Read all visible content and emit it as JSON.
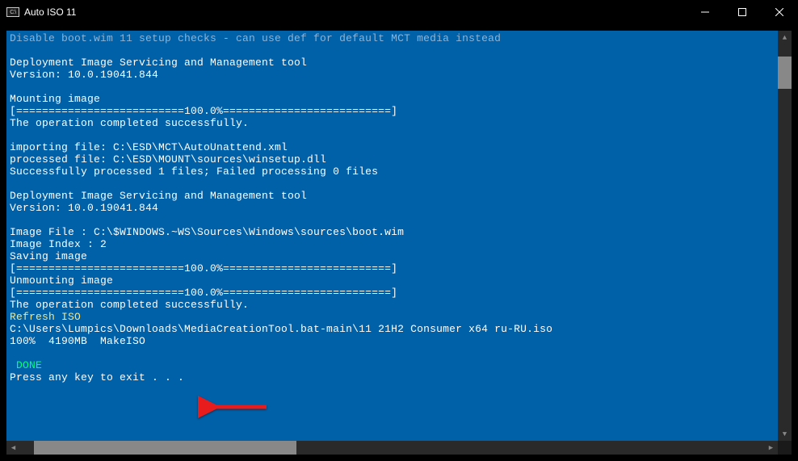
{
  "window": {
    "title": "Auto ISO 11"
  },
  "terminal": {
    "lines": [
      {
        "text": "Disable boot.wim 11 setup checks - can use def for default MCT media instead",
        "class": "gray-text"
      },
      {
        "text": "",
        "class": ""
      },
      {
        "text": "Deployment Image Servicing and Management tool",
        "class": ""
      },
      {
        "text": "Version: 10.0.19041.844",
        "class": ""
      },
      {
        "text": "",
        "class": ""
      },
      {
        "text": "Mounting image",
        "class": ""
      },
      {
        "text": "[==========================100.0%==========================]",
        "class": ""
      },
      {
        "text": "The operation completed successfully.",
        "class": ""
      },
      {
        "text": "",
        "class": ""
      },
      {
        "text": "importing file: C:\\ESD\\MCT\\AutoUnattend.xml",
        "class": ""
      },
      {
        "text": "processed file: C:\\ESD\\MOUNT\\sources\\winsetup.dll",
        "class": ""
      },
      {
        "text": "Successfully processed 1 files; Failed processing 0 files",
        "class": ""
      },
      {
        "text": "",
        "class": ""
      },
      {
        "text": "Deployment Image Servicing and Management tool",
        "class": ""
      },
      {
        "text": "Version: 10.0.19041.844",
        "class": ""
      },
      {
        "text": "",
        "class": ""
      },
      {
        "text": "Image File : C:\\$WINDOWS.~WS\\Sources\\Windows\\sources\\boot.wim",
        "class": ""
      },
      {
        "text": "Image Index : 2",
        "class": ""
      },
      {
        "text": "Saving image",
        "class": ""
      },
      {
        "text": "[==========================100.0%==========================]",
        "class": ""
      },
      {
        "text": "Unmounting image",
        "class": ""
      },
      {
        "text": "[==========================100.0%==========================]",
        "class": ""
      },
      {
        "text": "The operation completed successfully.",
        "class": ""
      },
      {
        "text": "Refresh ISO",
        "class": "yellow-text"
      },
      {
        "text": "C:\\Users\\Lumpics\\Downloads\\MediaCreationTool.bat-main\\11 21H2 Consumer x64 ru-RU.iso",
        "class": ""
      },
      {
        "text": "100%  4190MB  MakeISO",
        "class": ""
      },
      {
        "text": "",
        "class": ""
      },
      {
        "text": " DONE",
        "class": "green-text"
      },
      {
        "text": "Press any key to exit . . .",
        "class": ""
      }
    ]
  }
}
